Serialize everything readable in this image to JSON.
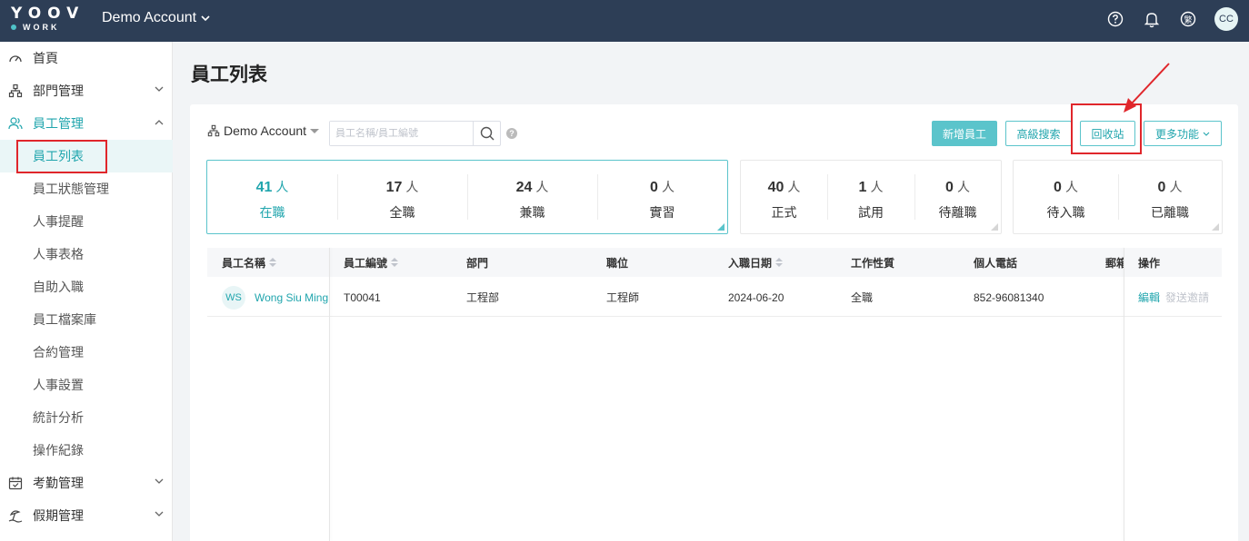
{
  "topbar": {
    "logo_line1": "YOOV",
    "logo_line2": "WORK",
    "account_label": "Demo Account",
    "language_label": "繁",
    "avatar_initials": "CC",
    "bg_color": "#2d3e56"
  },
  "sidebar": {
    "items": [
      {
        "label": "首頁",
        "icon": "dashboard-icon"
      },
      {
        "label": "部門管理",
        "icon": "org-chart-icon"
      },
      {
        "label": "員工管理",
        "icon": "users-icon"
      },
      {
        "label": "考勤管理",
        "icon": "calendar-check-icon"
      },
      {
        "label": "假期管理",
        "icon": "beach-icon"
      }
    ],
    "sub_items": [
      "員工列表",
      "員工狀態管理",
      "人事提醒",
      "人事表格",
      "自助入職",
      "員工檔案庫",
      "合約管理",
      "人事設置",
      "統計分析",
      "操作紀錄"
    ]
  },
  "main": {
    "title": "員工列表",
    "org_selector": "Demo Account",
    "search_placeholder": "員工名稱/員工編號",
    "buttons": {
      "add": "新增員工",
      "advanced": "高級搜索",
      "recycle": "回收站",
      "more": "更多功能"
    },
    "stats_group1": [
      {
        "num": "41",
        "unit": "人",
        "label": "在職"
      },
      {
        "num": "17",
        "unit": "人",
        "label": "全職"
      },
      {
        "num": "24",
        "unit": "人",
        "label": "兼職"
      },
      {
        "num": "0",
        "unit": "人",
        "label": "實習"
      }
    ],
    "stats_group2": [
      {
        "num": "40",
        "unit": "人",
        "label": "正式"
      },
      {
        "num": "1",
        "unit": "人",
        "label": "試用"
      },
      {
        "num": "0",
        "unit": "人",
        "label": "待離職"
      }
    ],
    "stats_group3": [
      {
        "num": "0",
        "unit": "人",
        "label": "待入職"
      },
      {
        "num": "0",
        "unit": "人",
        "label": "已離職"
      }
    ],
    "table": {
      "headers": [
        "員工名稱",
        "員工編號",
        "部門",
        "職位",
        "入職日期",
        "工作性質",
        "個人電話",
        "郵箱",
        "操作"
      ],
      "rows": [
        {
          "initials": "WS",
          "name": "Wong Siu Ming",
          "id": "T00041",
          "dept": "工程部",
          "position": "工程師",
          "join_date": "2024-06-20",
          "nature": "全職",
          "phone": "852-96081340",
          "op_edit": "編輯",
          "op_invite": "發送邀請"
        }
      ]
    }
  },
  "colors": {
    "accent": "#20a5ad",
    "primary_button": "#5bc4cb",
    "annotation_red": "#e0262b"
  }
}
